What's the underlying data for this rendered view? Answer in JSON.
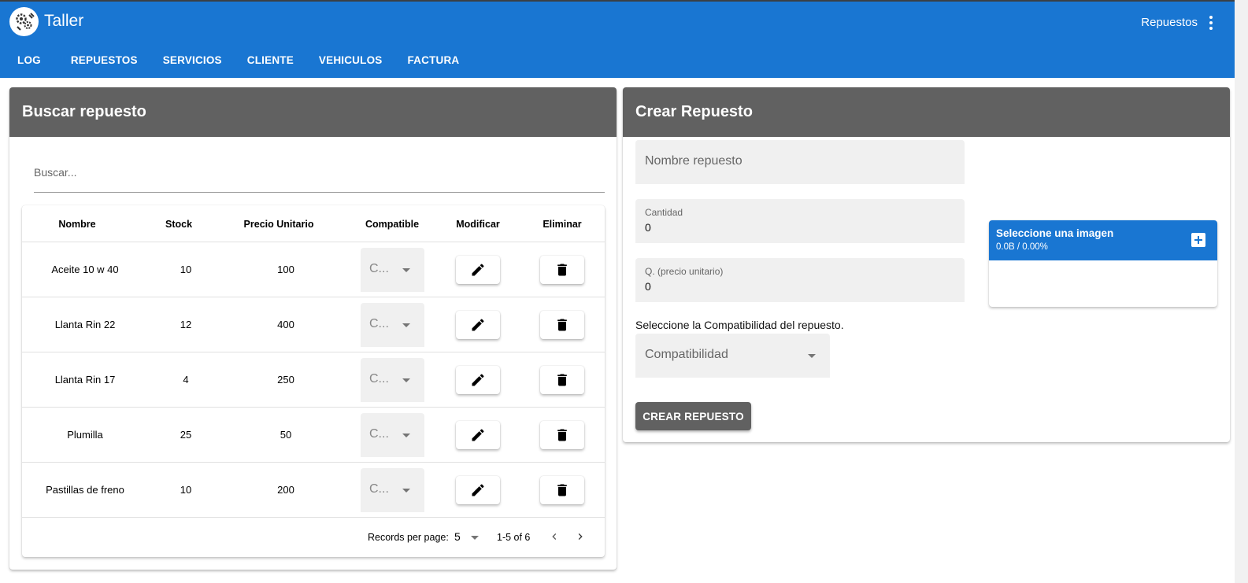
{
  "app": {
    "title": "Taller",
    "menu_label": "Repuestos",
    "tabs": [
      {
        "label": "LOG",
        "active": false
      },
      {
        "label": "REPUESTOS",
        "active": true
      },
      {
        "label": "SERVICIOS",
        "active": false
      },
      {
        "label": "CLIENTE",
        "active": false
      },
      {
        "label": "VEHICULOS",
        "active": false
      },
      {
        "label": "FACTURA",
        "active": false
      }
    ]
  },
  "search": {
    "title": "Buscar repuesto",
    "placeholder": "Buscar...",
    "columns": [
      "Nombre",
      "Stock",
      "Precio Unitario",
      "Compatible",
      "Modificar",
      "Eliminar"
    ],
    "rows": [
      {
        "nombre": "Aceite 10 w 40",
        "stock": "10",
        "precio": "100",
        "compatible": "C..."
      },
      {
        "nombre": "Llanta Rin 22",
        "stock": "12",
        "precio": "400",
        "compatible": "C..."
      },
      {
        "nombre": "Llanta Rin 17",
        "stock": "4",
        "precio": "250",
        "compatible": "C..."
      },
      {
        "nombre": "Plumilla",
        "stock": "25",
        "precio": "50",
        "compatible": "C..."
      },
      {
        "nombre": "Pastillas de freno",
        "stock": "10",
        "precio": "200",
        "compatible": "C..."
      }
    ],
    "footer": {
      "records_label": "Records per page:",
      "records_value": "5",
      "range": "1-5 of 6"
    }
  },
  "create": {
    "title": "Crear Repuesto",
    "nombre_label": "Nombre repuesto",
    "cantidad_label": "Cantidad",
    "cantidad_value": "0",
    "precio_label": "Q. (precio unitario)",
    "precio_value": "0",
    "compat_question": "Seleccione la Compatibilidad del repuesto.",
    "compat_placeholder": "Compatibilidad",
    "button_label": "CREAR REPUESTO",
    "upload": {
      "title": "Seleccione una imagen",
      "progress": "0.0B / 0.00%"
    }
  },
  "icons": {
    "logo": "gears-wrench-logo-icon",
    "menu": "more-vert-icon",
    "edit": "pencil-icon",
    "delete": "trash-icon",
    "dropdown": "caret-down-icon",
    "prev": "chevron-left-icon",
    "next": "chevron-right-icon",
    "add": "plus-box-icon"
  },
  "colors": {
    "primary": "#1976d2",
    "card_header": "#616161",
    "field_bg": "#f0f0f0"
  }
}
